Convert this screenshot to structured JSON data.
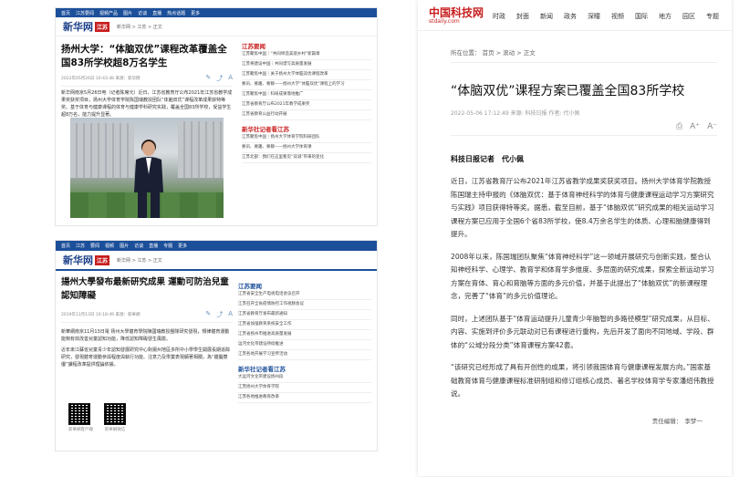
{
  "xinhua_top": {
    "nav": [
      "首页",
      "江苏要闻",
      "视频产品",
      "图片",
      "访谈",
      "直播",
      "热点话题",
      "更多"
    ],
    "logo_text": "新华网",
    "logo_tag": "江苏",
    "crumb": "新华网 > 江苏 > 正文",
    "title": "扬州大学：“体脑双优”课程改革覆盖全国83所学校超8万名学生",
    "meta": "2022年05月26日 10:43:48    来源：新华网",
    "paragraph": "新华网南京5月26日电（记者陈席元）近日，江苏省教育厅公布2021年江苏省教学成果奖获奖项目，扬州大学体育学院陈国瑞教授团队“体脑双优”课程改革成果获特等奖。基于体育与健康课程的体育与健康学科研究实践，覆盖全国83所学校，受益学生超8万名，能力提升显著。",
    "sidebar_head1": "江苏要闻",
    "sidebar_items1": [
      "江苏聚焦中国｜“共同缔造美丽乡村”新篇章",
      "江苏将建设中国｜共同谱写高质量发展",
      "江苏聚焦中国｜关于扬州大学体脑双优课程改革",
      "要讯、要趣、要聊——扬州大学“体脑双优”课程上的学习",
      "江苏聚焦中国｜科研成果落地推广",
      "江苏省教育厅公布2021年教学成果奖",
      "江苏省教育公益行动开展"
    ],
    "sidebar_head2": "新华社记者看江苏",
    "sidebar_items2": [
      "江苏聚焦中国｜扬州大学体育学院科研团队",
      "要讯、要趣、要聊——扬州大学体育课",
      "江苏北部：我们在这里看见“双减”带来的变化"
    ]
  },
  "xinhua_bottom": {
    "nav": [
      "首页",
      "江苏",
      "要闻",
      "视频",
      "图片",
      "访谈",
      "直播",
      "专题",
      "更多"
    ],
    "logo_text": "新华网",
    "logo_tag": "江苏",
    "crumb": "新华网 > 江苏 > 正文",
    "title": "揚州大學發布最新研究成果 運動可防治兒童認知障礙",
    "meta": "2019年11月13日 10:18:49    來源：新華網",
    "paragraph1": "新華網南京11月13日電 扬州大學體育學院陳國瑞教授團隊研究發現，規律體育運動能夠有效改善兒童認知功能，降低認知障礙發生風險。",
    "paragraph2": "近年來江蘇省兒童青少年認知發展研究中心對揚州地區多所中小學學生開展長期追踪研究，發現體育運動參與程度與執行功能、注意力及學業表現顯著相關，為“體腦雙優”課程改革提供理論依據。",
    "qr_labels": [
      "新華網客戶端",
      "新華網微信"
    ],
    "sidebar_head1": "江苏要闻",
    "sidebar_items1": [
      "江苏省安全生产电视电话会议召开",
      "江苏召开全省疫情防控工作视频会议",
      "江苏省教育厅发布最新通知",
      "江苏省加强教育系统安全工作",
      "江苏省扬州市推进高质量发展",
      "运河文化带建设持续推进",
      "江苏各地开展学习宣传活动"
    ],
    "sidebar_head2": "新华社记者看江苏",
    "sidebar_items2": [
      "大运河文化带建设扬州段",
      "江苏扬州大学体育学院",
      "江苏各地推进教育改革"
    ]
  },
  "stdaily": {
    "logo_main": "中国科技网",
    "logo_sub": "stdaily.com",
    "nav": [
      "时政",
      "封面",
      "新闻",
      "政务",
      "深瞳",
      "视频",
      "国际",
      "地方",
      "园区",
      "专题"
    ],
    "crumb": "所在位置： 首页 > 滚动 > 正文",
    "title": "“体脑双优”课程方案已覆盖全国83所学校",
    "meta": "2022-05-06 17:12:49  来源: 科技日报  作者: 代小佩",
    "author_line": "科技日报记者　代小佩",
    "paragraphs": [
      "近日，江苏省教育厅公布2021年江苏省教学成果奖获奖项目。扬州大学体育学院教授陈国瑞主持申报的《体脑双优：基于体育神经科学的体育与健康课程运动学习方案研究与实践》项目获得特等奖。据悉，截至目前，基于“体脑双优”研究成果的相关运动学习课程方案已应用于全国6个省83所学校，使8.4万余名学生的体质、心理和脑健康得到提升。",
      "2008年以来，陈国瑞团队聚焦“体育神经科学”这一领域开展研究与创新实践，整合认知神经科学、心理学、教育学和体育学多维度、多层面的研究成果，探索全新运动学习方案在育体、育心和育脑等方面的多元价值，并基于此提出了“体脑双优”的新课程理念，完善了“体育”的多元价值理论。",
      "同时，上述团队基于“体育运动提升儿童青少年脑智的多路径模型”研究成果，从目标、内容、实施到评价多元联动对已有课程进行重构，先后开发了面向不同地域、学段、群体的“公域分段分类”体育课程方案42套。",
      "“该研究已经形成了具有开创性的成果，将引领我国体育与健康课程发展方向。”国家基础教育体育与健康课程标准研制组和修订组核心成员、著名学校体育学专家潘绍伟教授说。"
    ],
    "editor": "责任编辑：　李梦一",
    "accent_red": "#c81e1e",
    "accent_blue": "#1c4f9a"
  }
}
